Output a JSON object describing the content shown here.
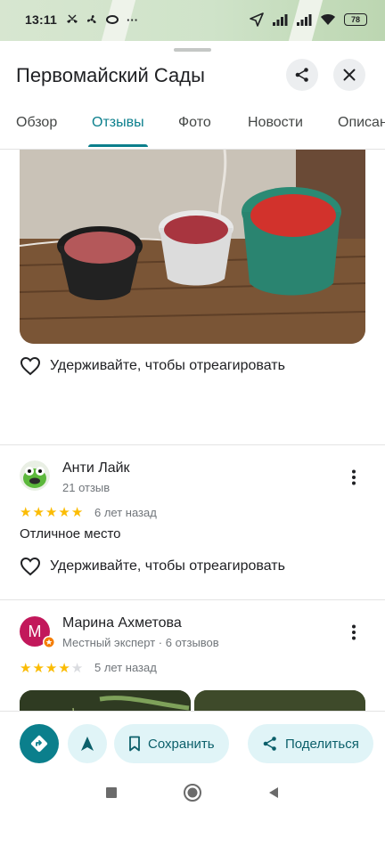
{
  "status_bar": {
    "time": "13:11",
    "battery": "78",
    "left_icons": [
      "missed-call-icon",
      "fan-icon",
      "fan-icon",
      "link-icon",
      "more-dots-icon"
    ],
    "right_icons": [
      "navigation-icon",
      "signal-icon",
      "signal-icon",
      "wifi-icon",
      "battery-icon"
    ]
  },
  "place": {
    "title": "Первомайский Сады"
  },
  "tabs": [
    {
      "label": "Обзор",
      "active": false
    },
    {
      "label": "Отзывы",
      "active": true
    },
    {
      "label": "Фото",
      "active": false
    },
    {
      "label": "Новости",
      "active": false
    },
    {
      "label": "Описан",
      "active": false
    }
  ],
  "first_review": {
    "react_label": "Удерживайте, чтобы отреагировать"
  },
  "reviews": [
    {
      "name": "Анти Лайк",
      "meta": "21 отзыв",
      "rating": 5,
      "time_ago": "6 лет назад",
      "text": "Отличное место",
      "react_label": "Удерживайте, чтобы отреагировать"
    },
    {
      "name": "Марина Ахметова",
      "meta": "Местный эксперт · 6 отзывов",
      "avatar_letter": "М",
      "rating": 4,
      "time_ago": "5 лет назад"
    }
  ],
  "actions": {
    "save": "Сохранить",
    "share": "Поделиться"
  },
  "colors": {
    "accent": "#0b7f8c",
    "accent_light": "#e0f4f7",
    "star": "#fbbc04",
    "avatar_magenta": "#c2185b"
  }
}
